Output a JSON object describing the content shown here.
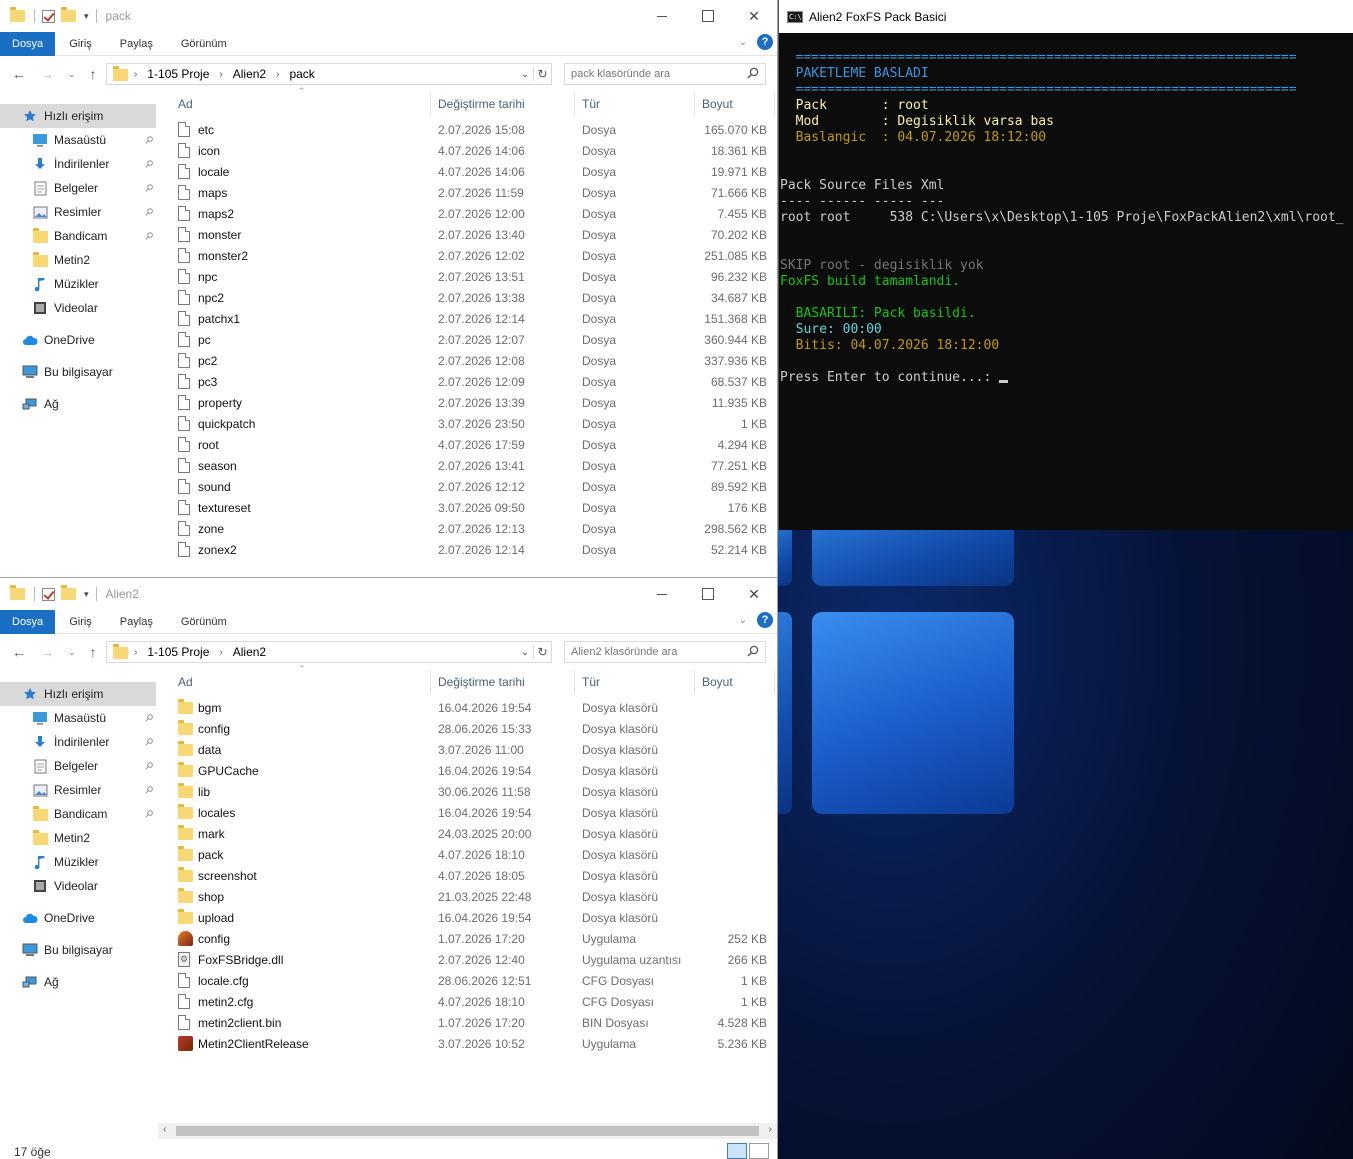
{
  "explorer_top": {
    "title": "pack",
    "ribbon_tabs": [
      "Dosya",
      "Giriş",
      "Paylaş",
      "Görünüm"
    ],
    "help": "?",
    "breadcrumb": [
      "1-105 Proje",
      "Alien2",
      "pack"
    ],
    "search_placeholder": "pack klasöründe ara",
    "columns": {
      "name": "Ad",
      "date": "Değiştirme tarihi",
      "type": "Tür",
      "size": "Boyut"
    },
    "files": [
      {
        "name": "etc",
        "date": "2.07.2026 15:08",
        "type": "Dosya",
        "size": "165.070 KB"
      },
      {
        "name": "icon",
        "date": "4.07.2026 14:06",
        "type": "Dosya",
        "size": "18.361 KB"
      },
      {
        "name": "locale",
        "date": "4.07.2026 14:06",
        "type": "Dosya",
        "size": "19.971 KB"
      },
      {
        "name": "maps",
        "date": "2.07.2026 11:59",
        "type": "Dosya",
        "size": "71.666 KB"
      },
      {
        "name": "maps2",
        "date": "2.07.2026 12:00",
        "type": "Dosya",
        "size": "7.455 KB"
      },
      {
        "name": "monster",
        "date": "2.07.2026 13:40",
        "type": "Dosya",
        "size": "70.202 KB"
      },
      {
        "name": "monster2",
        "date": "2.07.2026 12:02",
        "type": "Dosya",
        "size": "251.085 KB"
      },
      {
        "name": "npc",
        "date": "2.07.2026 13:51",
        "type": "Dosya",
        "size": "96.232 KB"
      },
      {
        "name": "npc2",
        "date": "2.07.2026 13:38",
        "type": "Dosya",
        "size": "34.687 KB"
      },
      {
        "name": "patchx1",
        "date": "2.07.2026 12:14",
        "type": "Dosya",
        "size": "151.368 KB"
      },
      {
        "name": "pc",
        "date": "2.07.2026 12:07",
        "type": "Dosya",
        "size": "360.944 KB"
      },
      {
        "name": "pc2",
        "date": "2.07.2026 12:08",
        "type": "Dosya",
        "size": "337.936 KB"
      },
      {
        "name": "pc3",
        "date": "2.07.2026 12:09",
        "type": "Dosya",
        "size": "68.537 KB"
      },
      {
        "name": "property",
        "date": "2.07.2026 13:39",
        "type": "Dosya",
        "size": "11.935 KB"
      },
      {
        "name": "quickpatch",
        "date": "3.07.2026 23:50",
        "type": "Dosya",
        "size": "1 KB"
      },
      {
        "name": "root",
        "date": "4.07.2026 17:59",
        "type": "Dosya",
        "size": "4.294 KB"
      },
      {
        "name": "season",
        "date": "2.07.2026 13:41",
        "type": "Dosya",
        "size": "77.251 KB"
      },
      {
        "name": "sound",
        "date": "2.07.2026 12:12",
        "type": "Dosya",
        "size": "89.592 KB"
      },
      {
        "name": "textureset",
        "date": "3.07.2026 09:50",
        "type": "Dosya",
        "size": "176 KB"
      },
      {
        "name": "zone",
        "date": "2.07.2026 12:13",
        "type": "Dosya",
        "size": "298.562 KB"
      },
      {
        "name": "zonex2",
        "date": "2.07.2026 12:14",
        "type": "Dosya",
        "size": "52.214 KB"
      }
    ]
  },
  "explorer_bottom": {
    "title": "Alien2",
    "ribbon_tabs": [
      "Dosya",
      "Giriş",
      "Paylaş",
      "Görünüm"
    ],
    "help": "?",
    "breadcrumb": [
      "1-105 Proje",
      "Alien2"
    ],
    "search_placeholder": "Alien2 klasöründe ara",
    "columns": {
      "name": "Ad",
      "date": "Değiştirme tarihi",
      "type": "Tür",
      "size": "Boyut"
    },
    "files": [
      {
        "name": "bgm",
        "date": "16.04.2026 19:54",
        "type": "Dosya klasörü",
        "size": "",
        "icon": "folder"
      },
      {
        "name": "config",
        "date": "28.06.2026 15:33",
        "type": "Dosya klasörü",
        "size": "",
        "icon": "folder"
      },
      {
        "name": "data",
        "date": "3.07.2026 11:00",
        "type": "Dosya klasörü",
        "size": "",
        "icon": "folder"
      },
      {
        "name": "GPUCache",
        "date": "16.04.2026 19:54",
        "type": "Dosya klasörü",
        "size": "",
        "icon": "folder"
      },
      {
        "name": "lib",
        "date": "30.06.2026 11:58",
        "type": "Dosya klasörü",
        "size": "",
        "icon": "folder"
      },
      {
        "name": "locales",
        "date": "16.04.2026 19:54",
        "type": "Dosya klasörü",
        "size": "",
        "icon": "folder"
      },
      {
        "name": "mark",
        "date": "24.03.2025 20:00",
        "type": "Dosya klasörü",
        "size": "",
        "icon": "folder"
      },
      {
        "name": "pack",
        "date": "4.07.2026 18:10",
        "type": "Dosya klasörü",
        "size": "",
        "icon": "folder"
      },
      {
        "name": "screenshot",
        "date": "4.07.2026 18:05",
        "type": "Dosya klasörü",
        "size": "",
        "icon": "folder"
      },
      {
        "name": "shop",
        "date": "21.03.2025 22:48",
        "type": "Dosya klasörü",
        "size": "",
        "icon": "folder"
      },
      {
        "name": "upload",
        "date": "16.04.2026 19:54",
        "type": "Dosya klasörü",
        "size": "",
        "icon": "folder"
      },
      {
        "name": "config",
        "date": "1.07.2026 17:20",
        "type": "Uygulama",
        "size": "252 KB",
        "icon": "app2"
      },
      {
        "name": "FoxFSBridge.dll",
        "date": "2.07.2026 12:40",
        "type": "Uygulama uzantısı",
        "size": "266 KB",
        "icon": "dll"
      },
      {
        "name": "locale.cfg",
        "date": "28.06.2026 12:51",
        "type": "CFG Dosyası",
        "size": "1 KB",
        "icon": "doc"
      },
      {
        "name": "metin2.cfg",
        "date": "4.07.2026 18:10",
        "type": "CFG Dosyası",
        "size": "1 KB",
        "icon": "doc"
      },
      {
        "name": "metin2client.bin",
        "date": "1.07.2026 17:20",
        "type": "BIN Dosyası",
        "size": "4.528 KB",
        "icon": "doc"
      },
      {
        "name": "Metin2ClientRelease",
        "date": "3.07.2026 10:52",
        "type": "Uygulama",
        "size": "5.236 KB",
        "icon": "app"
      }
    ],
    "status": "17 öğe"
  },
  "nav_pane": [
    {
      "label": "Hızlı erişim",
      "icon": "star-icon",
      "level": 0,
      "selected": true
    },
    {
      "label": "Masaüstü",
      "icon": "desktop-icon",
      "level": 1,
      "pinned": true
    },
    {
      "label": "İndirilenler",
      "icon": "download-icon",
      "level": 1,
      "pinned": true
    },
    {
      "label": "Belgeler",
      "icon": "documents-icon",
      "level": 1,
      "pinned": true
    },
    {
      "label": "Resimler",
      "icon": "pictures-icon",
      "level": 1,
      "pinned": true
    },
    {
      "label": "Bandicam",
      "icon": "folder-icon",
      "level": 1,
      "pinned": true
    },
    {
      "label": "Metin2",
      "icon": "folder-icon",
      "level": 1,
      "pinned": false
    },
    {
      "label": "Müzikler",
      "icon": "music-icon",
      "level": 1,
      "pinned": false
    },
    {
      "label": "Videolar",
      "icon": "video-icon",
      "level": 1,
      "pinned": false
    },
    {
      "label": "OneDrive",
      "icon": "cloud-icon",
      "level": 0,
      "gap": true
    },
    {
      "label": "Bu bilgisayar",
      "icon": "computer-icon",
      "level": 0,
      "gap": true
    },
    {
      "label": "Ağ",
      "icon": "network-icon",
      "level": 0,
      "gap": true
    }
  ],
  "console": {
    "title": "Alien2 FoxFS Pack Basici",
    "lines": [
      {
        "text": "  ================================================================",
        "color": "col-cyan"
      },
      {
        "text": "  PAKETLEME BASLADI",
        "color": "col-cyan"
      },
      {
        "text": "  ================================================================",
        "color": "col-cyan"
      },
      {
        "text": "  Pack       : root",
        "color": "col-byellow"
      },
      {
        "text": "  Mod        : Degisiklik varsa bas",
        "color": "col-byellow"
      },
      {
        "text": "  Baslangic  : 04.07.2026 18:12:00",
        "color": "col-yellow"
      },
      {
        "text": "",
        "color": "col-white"
      },
      {
        "text": "",
        "color": "col-white"
      },
      {
        "text": "Pack Source Files Xml",
        "color": "col-white"
      },
      {
        "text": "---- ------ ----- ---",
        "color": "col-white"
      },
      {
        "text": "root root     538 C:\\Users\\x\\Desktop\\1-105 Proje\\FoxPackAlien2\\xml\\root_",
        "color": "col-white"
      },
      {
        "text": "",
        "color": "col-white"
      },
      {
        "text": "",
        "color": "col-white"
      },
      {
        "text": "SKIP root - degisiklik yok",
        "color": "col-gray"
      },
      {
        "text": "FoxFS build tamamlandi.",
        "color": "col-lgreen"
      },
      {
        "text": "",
        "color": "col-white"
      },
      {
        "text": "  BASARILI: Pack basildi.",
        "color": "col-lgreen"
      },
      {
        "text": "  Sure: 00:00",
        "color": "col-bcyan"
      },
      {
        "text": "  Bitis: 04.07.2026 18:12:00",
        "color": "col-yellow"
      },
      {
        "text": "",
        "color": "col-white"
      },
      {
        "text": "Press Enter to continue...: ",
        "color": "col-white",
        "cursor": true
      }
    ]
  }
}
